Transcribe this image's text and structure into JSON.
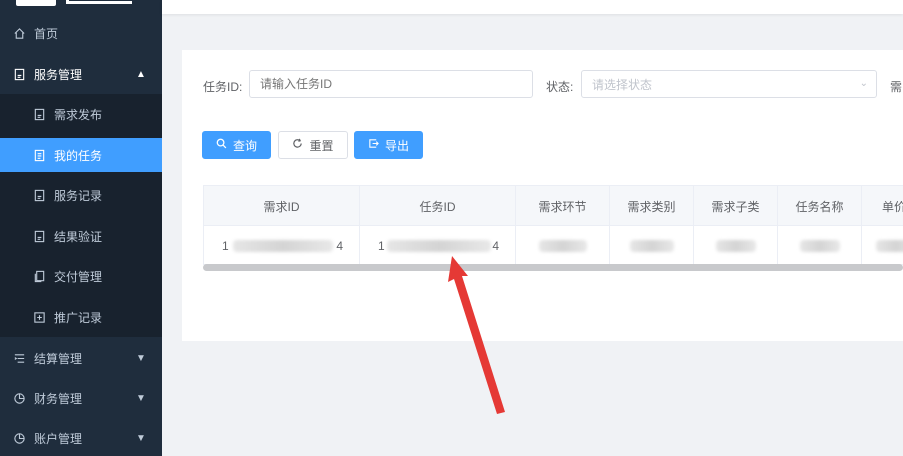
{
  "sidebar": {
    "items": [
      {
        "label": "首页",
        "icon": "home-icon"
      },
      {
        "label": "服务管理",
        "icon": "document-icon",
        "expanded": true
      },
      {
        "label": "结算管理",
        "icon": "list-icon"
      },
      {
        "label": "财务管理",
        "icon": "pie-chart-icon"
      },
      {
        "label": "账户管理",
        "icon": "pie-chart-icon"
      }
    ],
    "sub_items": [
      {
        "label": "需求发布",
        "icon": "document-icon"
      },
      {
        "label": "我的任务",
        "icon": "document-icon",
        "active": true
      },
      {
        "label": "服务记录",
        "icon": "document-icon"
      },
      {
        "label": "结果验证",
        "icon": "document-icon"
      },
      {
        "label": "交付管理",
        "icon": "copy-icon"
      },
      {
        "label": "推广记录",
        "icon": "plus-square-icon"
      }
    ]
  },
  "filters": {
    "task_id_label": "任务ID:",
    "task_id_placeholder": "请输入任务ID",
    "status_label": "状态:",
    "status_placeholder": "请选择状态",
    "extra_label": "需"
  },
  "buttons": {
    "search": "查询",
    "reset": "重置",
    "export": "导出"
  },
  "table": {
    "headers": [
      "需求ID",
      "任务ID",
      "需求环节",
      "需求类别",
      "需求子类",
      "任务名称",
      "单价"
    ],
    "row": {
      "demand_id_prefix": "1",
      "demand_id_suffix": "4",
      "task_id_prefix": "1",
      "task_id_suffix": "4"
    }
  },
  "colors": {
    "sidebar_bg": "#1f2d3d",
    "submenu_bg": "#18222e",
    "accent": "#409eff",
    "annotation_arrow": "#e53935"
  }
}
